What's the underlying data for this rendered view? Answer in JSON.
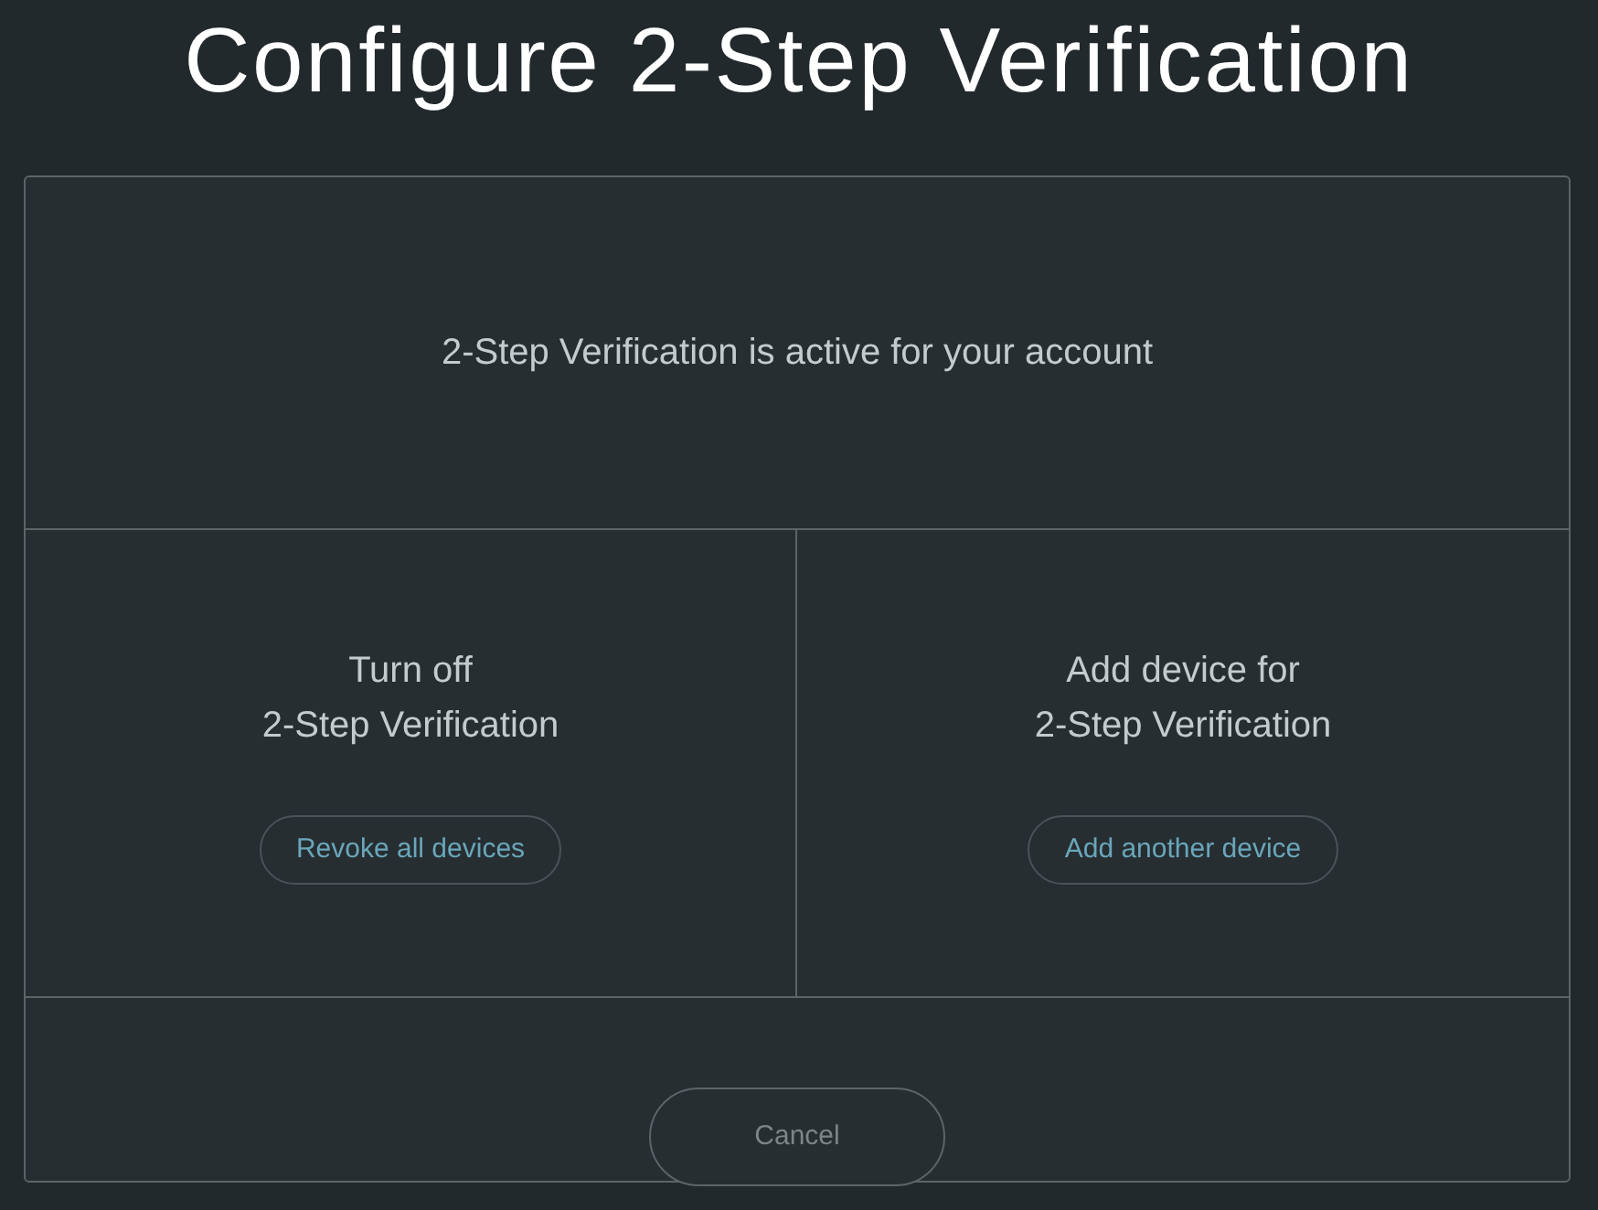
{
  "title": "Configure 2-Step Verification",
  "status_message": "2-Step Verification is active for your account",
  "actions": [
    {
      "heading": "Turn off\n2-Step Verification",
      "button": "Revoke all devices"
    },
    {
      "heading": "Add device for\n2-Step Verification",
      "button": "Add another device"
    }
  ],
  "cancel_button": "Cancel"
}
